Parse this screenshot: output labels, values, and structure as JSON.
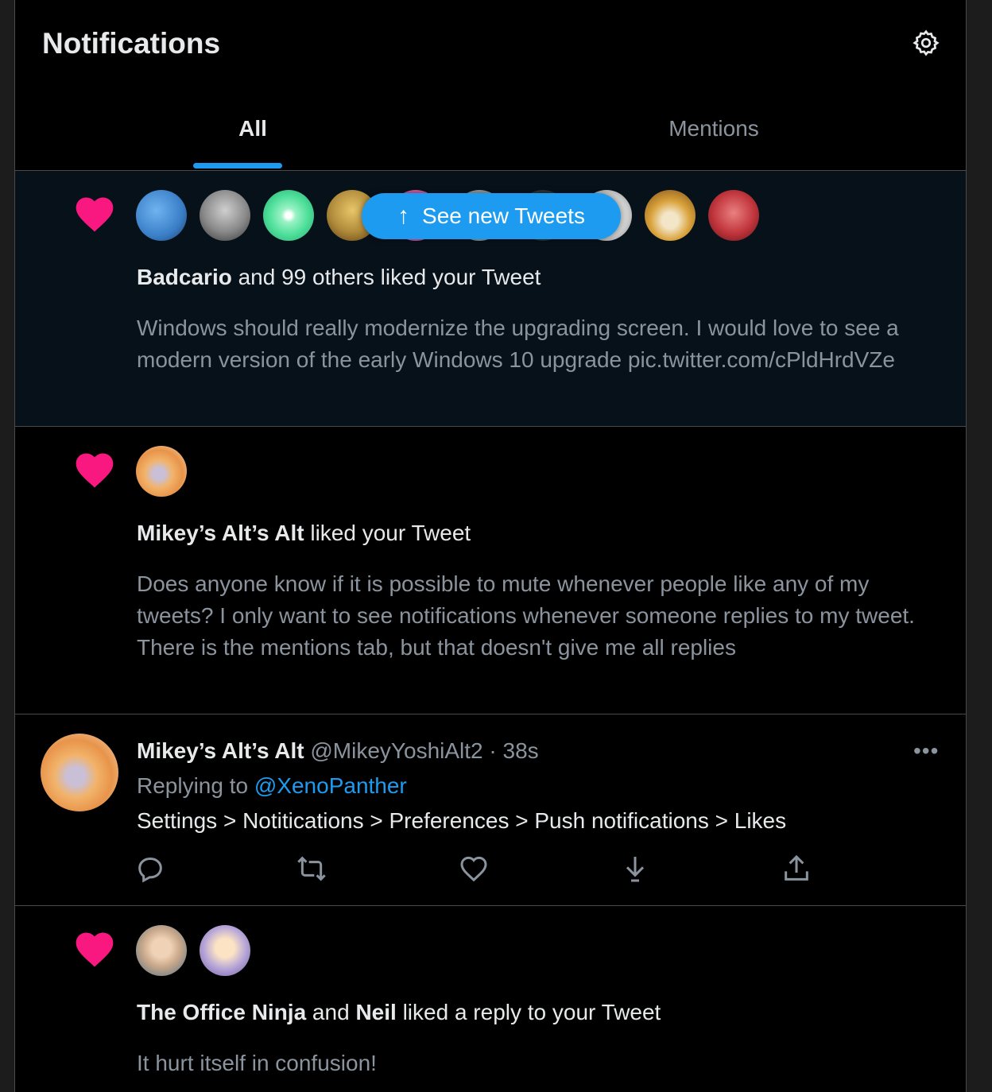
{
  "header": {
    "title": "Notifications",
    "settings_icon": "gear-icon"
  },
  "tabs": [
    {
      "label": "All",
      "active": true
    },
    {
      "label": "Mentions",
      "active": false
    }
  ],
  "new_tweets_pill": {
    "label": "See new Tweets",
    "icon": "arrow-up-icon"
  },
  "notifications": [
    {
      "type": "like",
      "actor": "Badcario",
      "rest": " and 99 others liked your Tweet",
      "snippet": "Windows should really modernize the upgrading screen. I would love to see a modern version of the early Windows 10 upgrade pic.twitter.com/cPldHrdVZe",
      "avatar_colors": [
        "#3a7fc7",
        "#888888",
        "#4ddf9a",
        "#b08a3a",
        "#d85ba0",
        "#9b9b9b",
        "#333333",
        "#cfcfcf",
        "#d9a23a",
        "#c0343b"
      ]
    },
    {
      "type": "like",
      "actor": "Mikey’s Alt’s Alt",
      "rest": " liked your Tweet",
      "snippet_lines": [
        "Does anyone know if it is possible to mute whenever people like any of my tweets? I only want to see notifications whenever someone replies to my tweet.",
        "There is the mentions tab, but that doesn't give me all replies"
      ],
      "avatar_colors": [
        "#e8944a"
      ]
    },
    {
      "type": "reply",
      "name": "Mikey’s Alt’s Alt",
      "handle_time": "@MikeyYoshiAlt2 · 38s",
      "replying_label": "Replying to ",
      "replying_to": "@XenoPanther",
      "body": "Settings > Notitications > Preferences > Push notifications > Likes",
      "more_label": "•••"
    },
    {
      "type": "like",
      "actor1": "The Office Ninja",
      "joiner": " and ",
      "actor2": "Neil",
      "rest": " liked a reply to your Tweet",
      "snippet": "It hurt itself in confusion!",
      "avatar_colors": [
        "#c9a88a",
        "#b7a6d8"
      ]
    }
  ],
  "colors": {
    "heart": "#f91880",
    "accent": "#1d9bf0",
    "muted": "#8b949e",
    "unread_bg": "#07111a"
  }
}
